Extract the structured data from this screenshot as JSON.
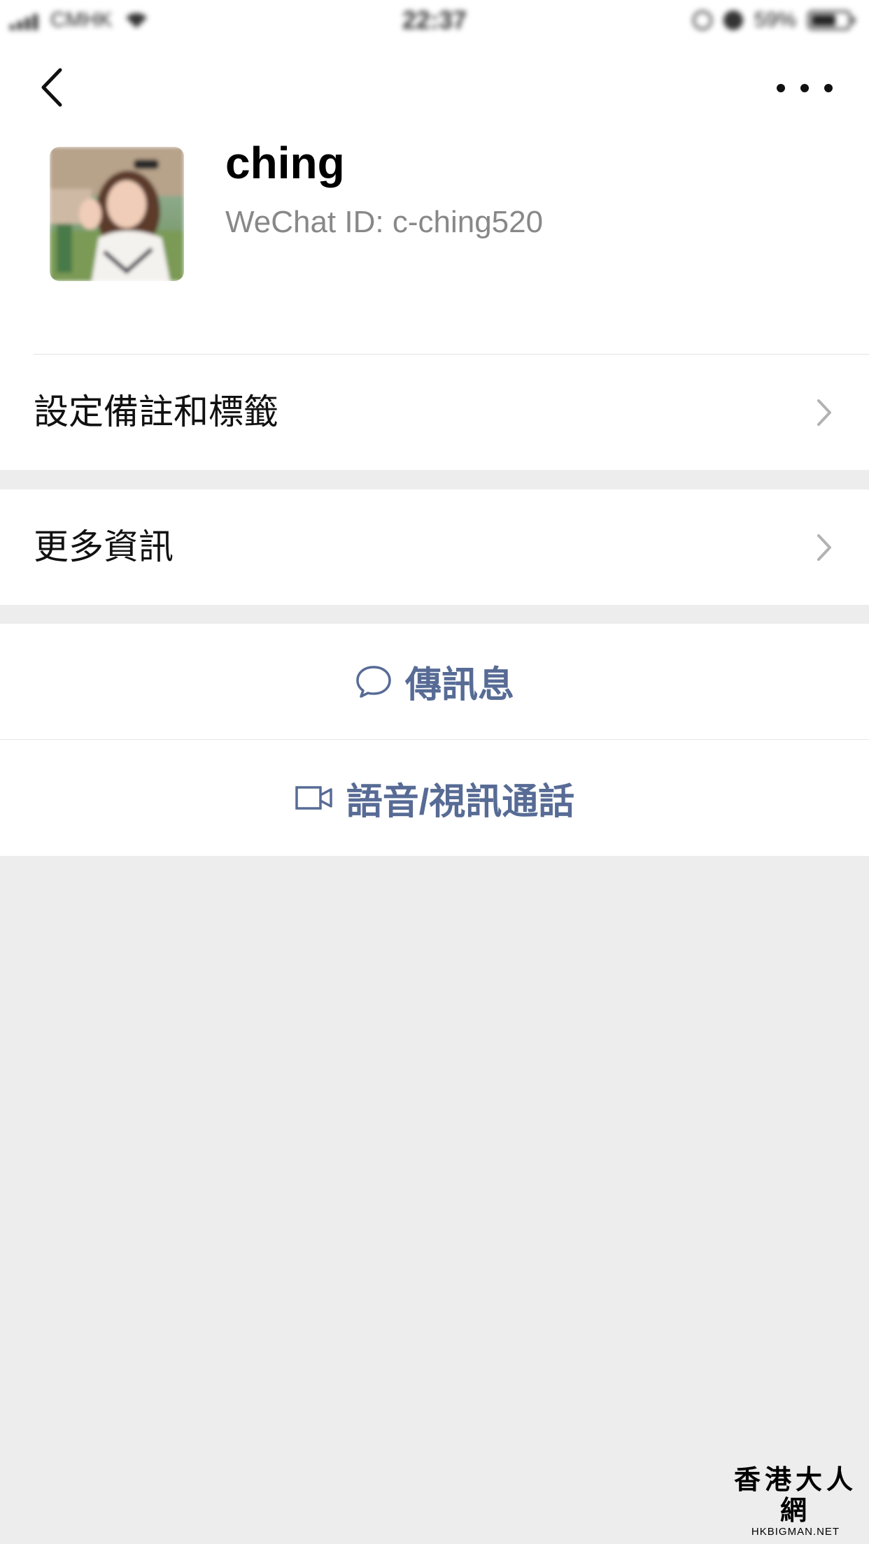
{
  "status_bar": {
    "carrier": "CMHK",
    "time": "22:37",
    "battery": "59%"
  },
  "nav": {
    "back_icon": "chevron-left-icon",
    "more_icon": "more-dots-icon"
  },
  "profile": {
    "name": "ching",
    "wechat_id": "WeChat ID: c-ching520"
  },
  "rows": [
    {
      "label": "設定備註和標籤",
      "icon": "chevron-right-icon"
    },
    {
      "label": "更多資訊",
      "icon": "chevron-right-icon"
    }
  ],
  "actions": {
    "message": {
      "label": "傳訊息",
      "icon": "chat-bubble-icon",
      "color": "#576b95"
    },
    "call": {
      "label": "語音/視訊通話",
      "icon": "video-camera-icon",
      "color": "#576b95"
    }
  },
  "watermark": {
    "main": "香港大人網",
    "sub": "HKBIGMAN.NET"
  }
}
